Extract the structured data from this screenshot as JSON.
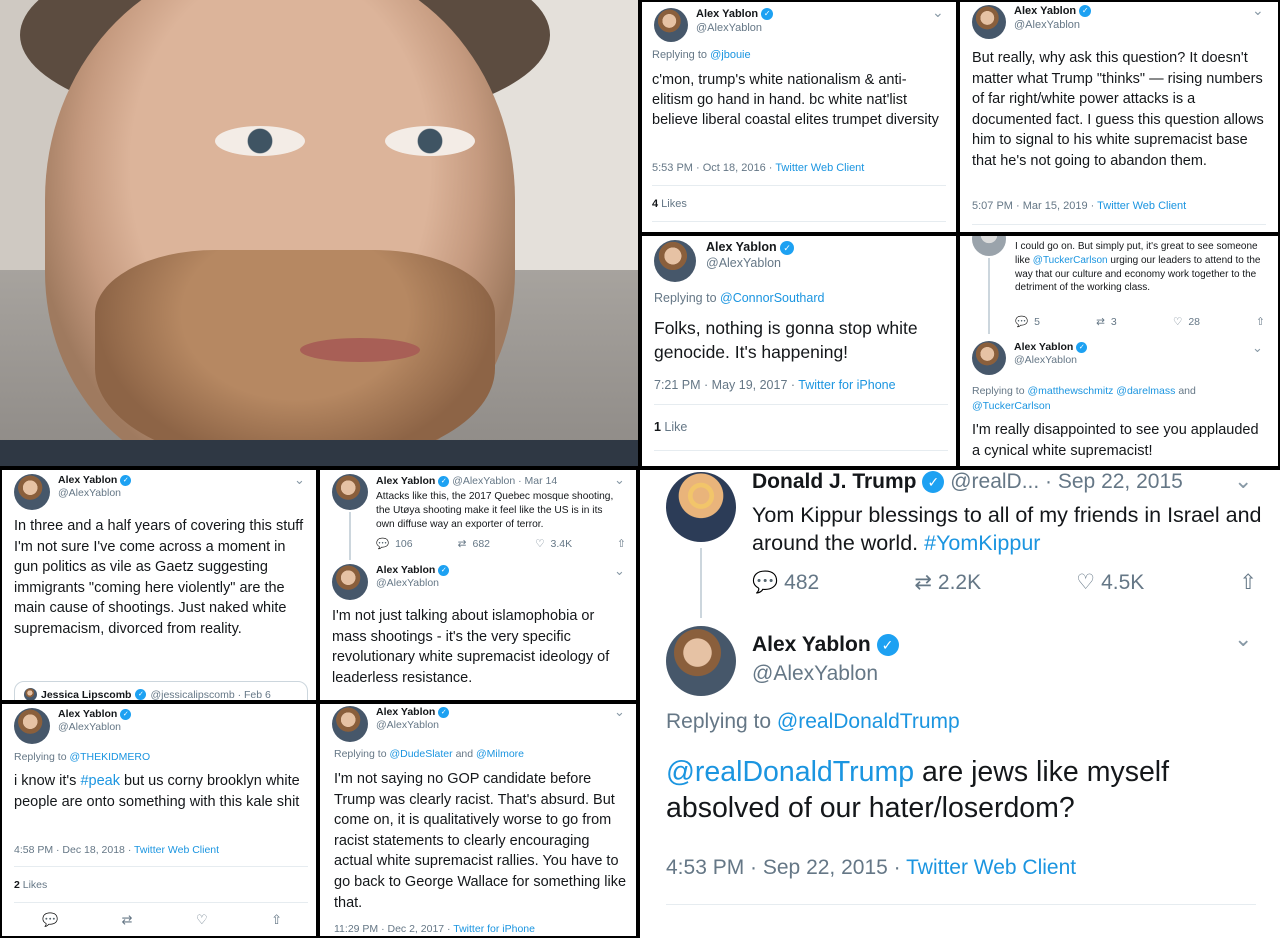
{
  "p1": {
    "name": "Alex Yablon",
    "handle": "@AlexYablon",
    "replying": "Replying to ",
    "replying_to": "@jbouie",
    "text": "c'mon, trump's white nationalism & anti-elitism go hand in hand. bc white nat'list believe liberal coastal elites trumpet diversity",
    "time": "5:53 PM · Oct 18, 2016 · ",
    "client": "Twitter Web Client",
    "likes_num": "4",
    "likes_label": " Likes"
  },
  "p2": {
    "name": "Alex Yablon",
    "handle": "@AlexYablon",
    "text": "But really, why ask this question? It doesn't matter what Trump \"thinks\" — rising numbers of far right/white power attacks is a documented fact. I guess this question allows him to signal to his white supremacist base that he's not going to abandon them.",
    "time": "5:07 PM · Mar 15, 2019 · ",
    "client": "Twitter Web Client"
  },
  "p3": {
    "name": "Alex Yablon",
    "handle": "@AlexYablon",
    "replying": "Replying to ",
    "replying_to": "@ConnorSouthard",
    "text": "Folks, nothing is gonna stop white genocide. It's happening!",
    "time": "7:21 PM · May 19, 2017 · ",
    "client": "Twitter for iPhone",
    "likes_num": "1",
    "likes_label": " Like"
  },
  "p4": {
    "parent_text_a": "I could go on. But simply put, it's great to see someone like ",
    "parent_mention": "@TuckerCarlson",
    "parent_text_b": " urging our leaders to attend to the way that our culture and economy work together to the detriment of the working class.",
    "replies": "5",
    "retweets": "3",
    "likes": "28",
    "name": "Alex Yablon",
    "handle": "@AlexYablon",
    "replying": "Replying to ",
    "replying_to": "@matthewschmitz @darelmass",
    "replying_and": " and ",
    "replying_to2": "@TuckerCarlson",
    "text": "I'm really disappointed to see you applauded a cynical white supremacist!"
  },
  "p5": {
    "name": "Alex Yablon",
    "handle": "@AlexYablon",
    "text": "In three and a half years of covering this stuff I'm not sure I've come across a moment in gun politics as vile as Gaetz suggesting immigrants \"coming here violently\" are the main cause of shootings. Just naked white supremacism, divorced from reality.",
    "quote_name": "Jessica Lipscomb",
    "quote_handle": "@jessicalipscomb · Feb 6"
  },
  "p6": {
    "name": "Alex Yablon",
    "handle_date": "@AlexYablon · Mar 14",
    "parent_text": "Attacks like this, the 2017 Quebec mosque shooting, the Utøya shooting make it feel like the US is in its own diffuse way an exporter of terror.",
    "replies": "106",
    "retweets": "682",
    "likes": "3.4K",
    "name2": "Alex Yablon",
    "handle2": "@AlexYablon",
    "text": "I'm not just talking about islamophobia or mass shootings - it's the very specific revolutionary white supremacist ideology of leaderless resistance."
  },
  "p7": {
    "trump_name": "Donald J. Trump",
    "trump_handle_date": "@realD... · Sep 22, 2015",
    "trump_text": "Yom Kippur blessings to all of my friends in Israel and around the world. ",
    "trump_tag": "#YomKippur",
    "replies": "482",
    "retweets": "2.2K",
    "likes": "4.5K",
    "name": "Alex Yablon",
    "handle": "@AlexYablon",
    "replying": "Replying to ",
    "replying_to": "@realDonaldTrump",
    "mention": "@realDonaldTrump",
    "text": " are jews like myself absolved of our hater/loserdom?",
    "time": "4:53 PM · Sep 22, 2015 · ",
    "client": "Twitter Web Client"
  },
  "p8": {
    "name": "Alex Yablon",
    "handle": "@AlexYablon",
    "replying": "Replying to ",
    "replying_to": "@THEKIDMERO",
    "text_a": "i know it's ",
    "tag": "#peak",
    "text_b": " but us corny brooklyn white people are onto something with this kale shit",
    "time": "4:58 PM · Dec 18, 2018 · ",
    "client": "Twitter Web Client",
    "likes_num": "2",
    "likes_label": " Likes"
  },
  "p9": {
    "name": "Alex Yablon",
    "handle": "@AlexYablon",
    "replying": "Replying to ",
    "replying_to": "@DudeSlater",
    "replying_and": " and ",
    "replying_to2": "@Milmore",
    "text": "I'm not saying no GOP candidate before Trump was clearly racist. That's absurd. But come on, it is qualitatively worse to go from racist statements to clearly encouraging actual white supremacist rallies. You have to go back to George Wallace for something like that.",
    "time": "11:29 PM · Dec 2, 2017 · ",
    "client": "Twitter for iPhone"
  },
  "icons": {
    "reply": "💬",
    "retweet": "⇄",
    "like": "♡",
    "share": "⇧",
    "chevron": "⌄",
    "check": "✓"
  },
  "colors": {
    "link": "#1b95e0",
    "verified": "#1da1f2",
    "muted": "#657786"
  }
}
